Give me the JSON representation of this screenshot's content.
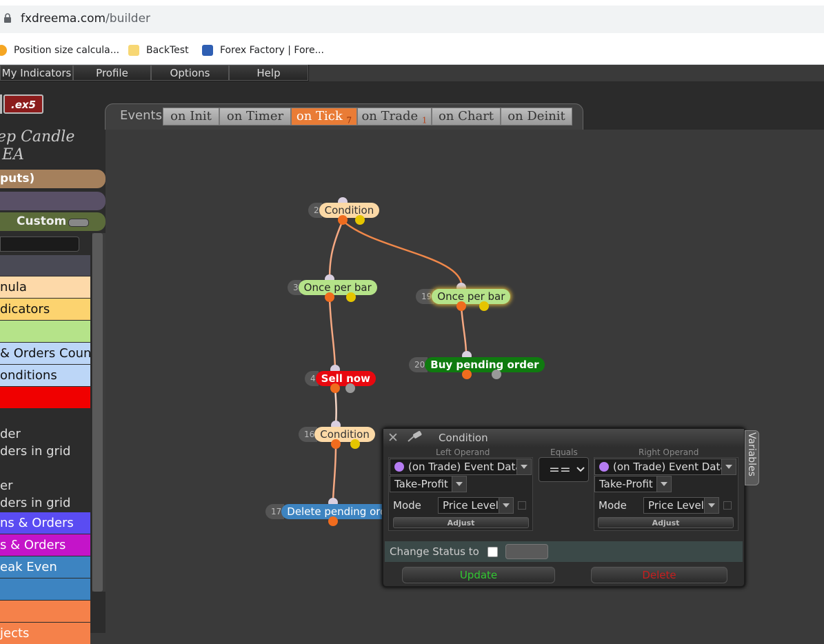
{
  "browser": {
    "url_host": "fxdreema.com",
    "url_path": "/builder",
    "bookmarks": [
      {
        "label": "Position size calcula...",
        "icon": "fx-favicon"
      },
      {
        "label": "BackTest",
        "icon": "folder-icon"
      },
      {
        "label": "Forex Factory | Fore...",
        "icon": "forex-factory-icon"
      }
    ]
  },
  "menu": [
    "My Indicators",
    "Profile",
    "Options",
    "Help"
  ],
  "ex5_button": ".ex5",
  "events_label": "Events",
  "tabs": [
    {
      "label": "on Init",
      "count": ""
    },
    {
      "label": "on Timer",
      "count": ""
    },
    {
      "label": "on Tick",
      "count": "7",
      "active": true
    },
    {
      "label": "on Trade",
      "count": "1"
    },
    {
      "label": "on Chart",
      "count": ""
    },
    {
      "label": "on Deinit",
      "count": ""
    }
  ],
  "sidebar": {
    "project_title_1": "ep Candle",
    "project_title_2": " EA",
    "inputs_pill": "puts)",
    "custom_pill": "Custom",
    "items": [
      {
        "label": "nula",
        "color": "#fdd9a9"
      },
      {
        "label": "dicators",
        "color": "#fcd36f"
      },
      {
        "label": "",
        "color": "#b5e389"
      },
      {
        "label": " & Orders Count",
        "color": "#bcd6f7"
      },
      {
        "label": "onditions",
        "color": "#bcd6f7"
      },
      {
        "label": "",
        "color": "#f00000"
      }
    ],
    "plain_items": [
      "der",
      "ders in grid",
      "er",
      "ders in grid"
    ],
    "items2": [
      {
        "label": "ns & Orders",
        "color": "#5a4cf2"
      },
      {
        "label": "s & Orders",
        "color": "#c414c9"
      },
      {
        "label": "eak Even",
        "color": "#3d84c1"
      },
      {
        "label": "",
        "color": "#3d84c1"
      },
      {
        "label": "",
        "color": "#f5814a"
      },
      {
        "label": "jects",
        "color": "#f5814a"
      }
    ]
  },
  "nodes": [
    {
      "id": "2",
      "label": "Condition",
      "kind": "condition"
    },
    {
      "id": "3",
      "label": "Once per bar",
      "kind": "once"
    },
    {
      "id": "19",
      "label": "Once per bar",
      "kind": "once"
    },
    {
      "id": "4",
      "label": "Sell now",
      "kind": "sell"
    },
    {
      "id": "20",
      "label": "Buy pending order",
      "kind": "buy"
    },
    {
      "id": "16",
      "label": "Condition",
      "kind": "condition"
    },
    {
      "id": "17",
      "label": "Delete pending ord",
      "kind": "delete"
    }
  ],
  "dialog": {
    "title": "Condition",
    "left_operand_label": "Left Operand",
    "equals_label": "Equals",
    "right_operand_label": "Right Operand",
    "left": {
      "source": "(on Trade) Event Data",
      "field": "Take-Profit",
      "mode_label": "Mode",
      "mode": "Price Level",
      "adjust": "Adjust"
    },
    "operator": "==",
    "right": {
      "source": "(on Trade) Event Data",
      "field": "Take-Profit",
      "mode_label": "Mode",
      "mode": "Price Level",
      "adjust": "Adjust"
    },
    "change_status_label": "Change Status to",
    "update_label": "Update",
    "delete_label": "Delete",
    "variables_tab": "Variables"
  },
  "colors": {
    "accent_tab": "#e97c36",
    "update": "#32c832",
    "delete": "#c81e1e"
  }
}
